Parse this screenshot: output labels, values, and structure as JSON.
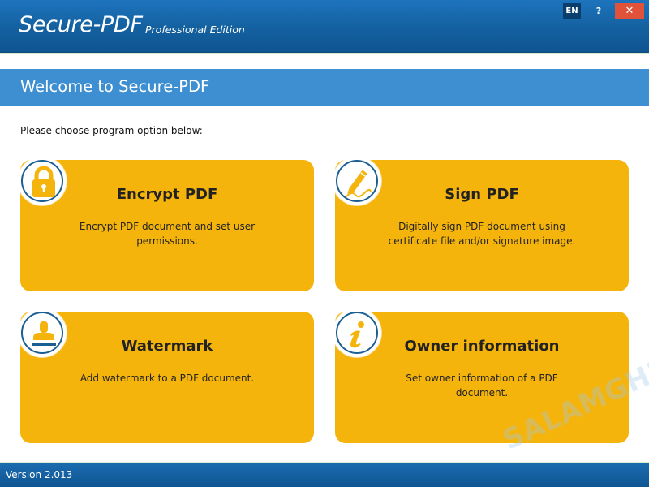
{
  "titlebar": {
    "app_name": "Secure-PDF",
    "edition": "Professional Edition",
    "language_label": "EN",
    "help_label": "?",
    "close_label": "✕"
  },
  "header": {
    "welcome": "Welcome to Secure-PDF"
  },
  "main": {
    "prompt": "Please choose program option below:",
    "cards": [
      {
        "title": "Encrypt PDF",
        "description": "Encrypt PDF document and set user permissions.",
        "icon": "padlock-icon"
      },
      {
        "title": "Sign PDF",
        "description": "Digitally sign PDF document using certificate file and/or signature image.",
        "icon": "pen-signature-icon"
      },
      {
        "title": "Watermark",
        "description": "Add watermark to a PDF document.",
        "icon": "stamp-icon"
      },
      {
        "title": "Owner information",
        "description": "Set owner information of a PDF document.",
        "icon": "info-icon"
      }
    ]
  },
  "watermark_text": "SALAMGHE",
  "status": {
    "version": "Version 2.013"
  },
  "colors": {
    "titlebar": "#14609f",
    "welcome_bar": "#3d8fd1",
    "card": "#f4b40c",
    "icon_outline": "#1b5e93",
    "icon_fill": "#f4b40c",
    "close_button": "#e0523a"
  }
}
